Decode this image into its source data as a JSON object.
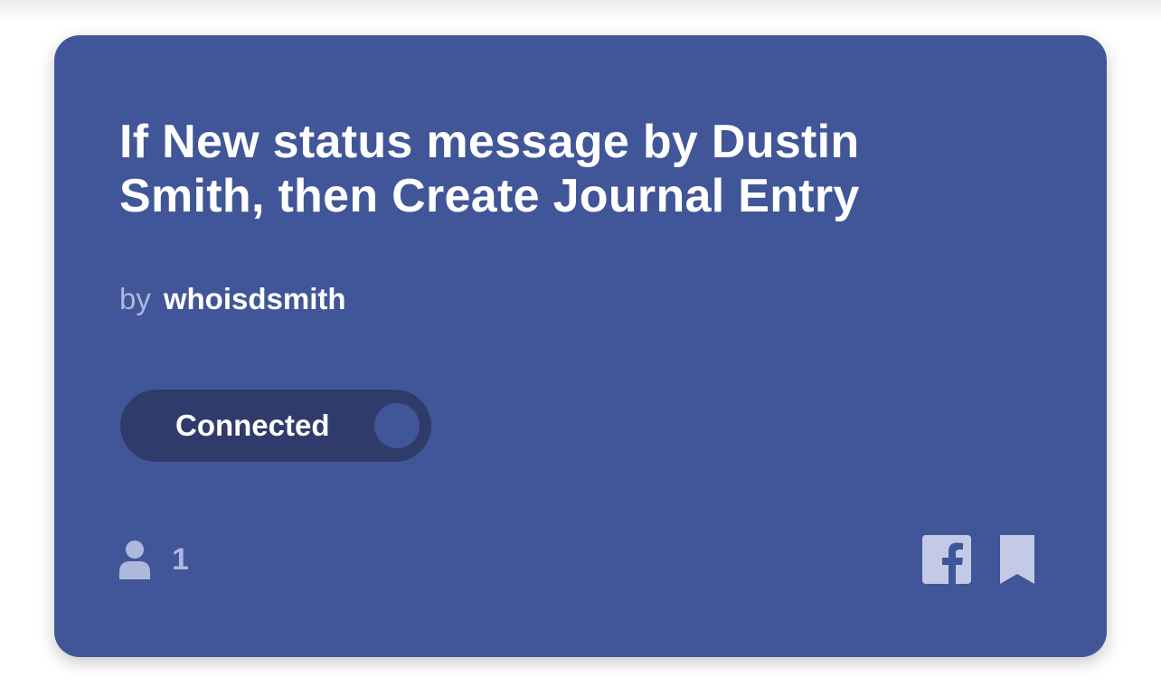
{
  "card": {
    "title": "If New status message by Dustin Smith, then Create Journal Entry",
    "author_prefix": "by",
    "author_name": "whoisdsmith",
    "background_color": "#415698"
  },
  "toggle": {
    "label": "Connected",
    "state": "on"
  },
  "footer": {
    "user_count": "1",
    "user_icon": "user-icon",
    "share_icon": "facebook-icon",
    "save_icon": "bookmark-icon"
  }
}
